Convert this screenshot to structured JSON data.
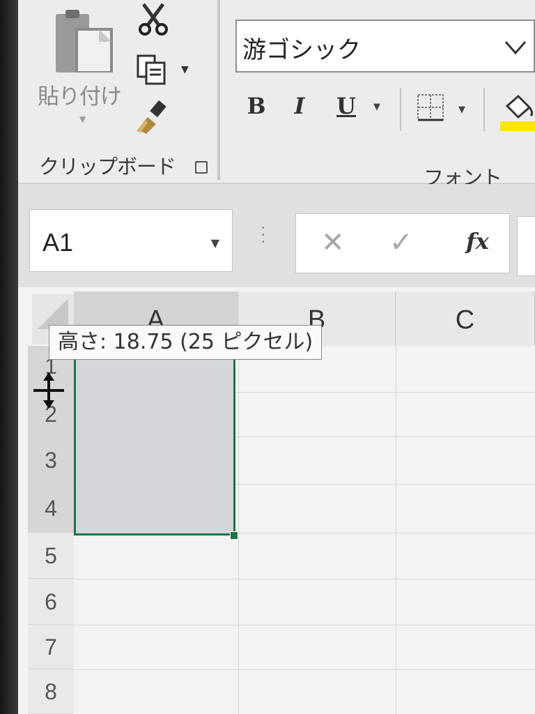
{
  "ribbon": {
    "clipboard": {
      "paste_label": "貼り付け",
      "group_label": "クリップボード",
      "icons": [
        "paste-icon",
        "cut-icon",
        "copy-icon",
        "format-painter-icon",
        "dialog-launcher-icon"
      ]
    },
    "font": {
      "font_name": "游ゴシック",
      "bold_label": "B",
      "italic_label": "I",
      "underline_label": "U",
      "group_label": "フォント",
      "icons": [
        "borders-icon",
        "fill-color-icon"
      ]
    }
  },
  "formula_bar": {
    "name_box": "A1",
    "cancel_glyph": "✕",
    "enter_glyph": "✓",
    "fx_label": "fx"
  },
  "sheet": {
    "columns": [
      "A",
      "B",
      "C"
    ],
    "rows": [
      "1",
      "2",
      "3",
      "4",
      "5",
      "6",
      "7",
      "8"
    ],
    "selected_range": "A1:A4"
  },
  "tooltip": {
    "text": "高さ: 18.75 (25 ピクセル)"
  },
  "colors": {
    "selection_border": "#217346",
    "ribbon_bg": "#ececec",
    "fill_color_bar": "#ffe600"
  }
}
